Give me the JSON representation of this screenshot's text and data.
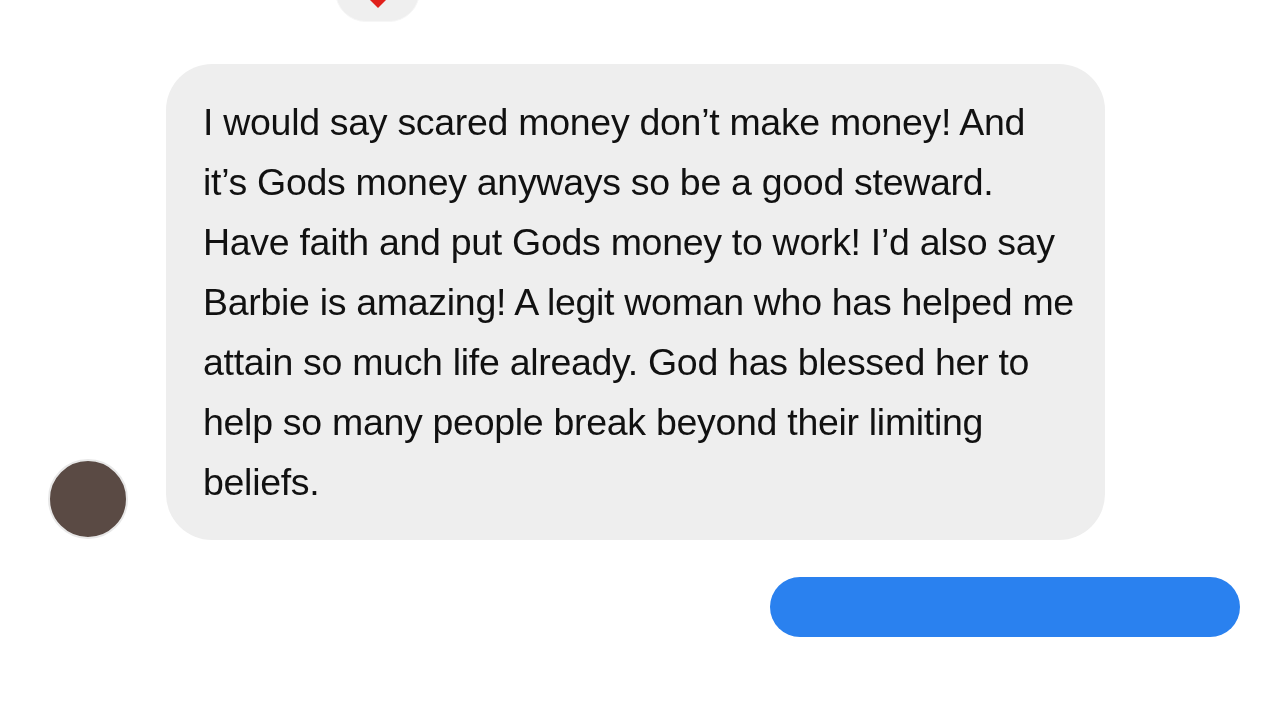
{
  "reaction": {
    "kind": "heart"
  },
  "message": {
    "text": "I would say scared money don’t make money! And it’s Gods money anyways so be a good steward. Have faith and put Gods money to work! I’d also say Barbie is amazing! A legit woman who has helped me attain so much life already. God has blessed her to help so many people break beyond their limiting beliefs."
  }
}
